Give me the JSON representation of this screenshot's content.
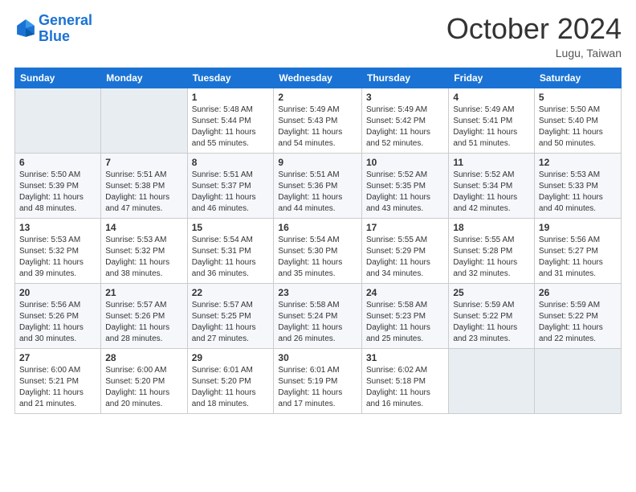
{
  "header": {
    "logo_line1": "General",
    "logo_line2": "Blue",
    "month_title": "October 2024",
    "location": "Lugu, Taiwan"
  },
  "days_of_week": [
    "Sunday",
    "Monday",
    "Tuesday",
    "Wednesday",
    "Thursday",
    "Friday",
    "Saturday"
  ],
  "weeks": [
    [
      {
        "day": "",
        "sunrise": "",
        "sunset": "",
        "daylight": ""
      },
      {
        "day": "",
        "sunrise": "",
        "sunset": "",
        "daylight": ""
      },
      {
        "day": "1",
        "sunrise": "Sunrise: 5:48 AM",
        "sunset": "Sunset: 5:44 PM",
        "daylight": "Daylight: 11 hours and 55 minutes."
      },
      {
        "day": "2",
        "sunrise": "Sunrise: 5:49 AM",
        "sunset": "Sunset: 5:43 PM",
        "daylight": "Daylight: 11 hours and 54 minutes."
      },
      {
        "day": "3",
        "sunrise": "Sunrise: 5:49 AM",
        "sunset": "Sunset: 5:42 PM",
        "daylight": "Daylight: 11 hours and 52 minutes."
      },
      {
        "day": "4",
        "sunrise": "Sunrise: 5:49 AM",
        "sunset": "Sunset: 5:41 PM",
        "daylight": "Daylight: 11 hours and 51 minutes."
      },
      {
        "day": "5",
        "sunrise": "Sunrise: 5:50 AM",
        "sunset": "Sunset: 5:40 PM",
        "daylight": "Daylight: 11 hours and 50 minutes."
      }
    ],
    [
      {
        "day": "6",
        "sunrise": "Sunrise: 5:50 AM",
        "sunset": "Sunset: 5:39 PM",
        "daylight": "Daylight: 11 hours and 48 minutes."
      },
      {
        "day": "7",
        "sunrise": "Sunrise: 5:51 AM",
        "sunset": "Sunset: 5:38 PM",
        "daylight": "Daylight: 11 hours and 47 minutes."
      },
      {
        "day": "8",
        "sunrise": "Sunrise: 5:51 AM",
        "sunset": "Sunset: 5:37 PM",
        "daylight": "Daylight: 11 hours and 46 minutes."
      },
      {
        "day": "9",
        "sunrise": "Sunrise: 5:51 AM",
        "sunset": "Sunset: 5:36 PM",
        "daylight": "Daylight: 11 hours and 44 minutes."
      },
      {
        "day": "10",
        "sunrise": "Sunrise: 5:52 AM",
        "sunset": "Sunset: 5:35 PM",
        "daylight": "Daylight: 11 hours and 43 minutes."
      },
      {
        "day": "11",
        "sunrise": "Sunrise: 5:52 AM",
        "sunset": "Sunset: 5:34 PM",
        "daylight": "Daylight: 11 hours and 42 minutes."
      },
      {
        "day": "12",
        "sunrise": "Sunrise: 5:53 AM",
        "sunset": "Sunset: 5:33 PM",
        "daylight": "Daylight: 11 hours and 40 minutes."
      }
    ],
    [
      {
        "day": "13",
        "sunrise": "Sunrise: 5:53 AM",
        "sunset": "Sunset: 5:32 PM",
        "daylight": "Daylight: 11 hours and 39 minutes."
      },
      {
        "day": "14",
        "sunrise": "Sunrise: 5:53 AM",
        "sunset": "Sunset: 5:32 PM",
        "daylight": "Daylight: 11 hours and 38 minutes."
      },
      {
        "day": "15",
        "sunrise": "Sunrise: 5:54 AM",
        "sunset": "Sunset: 5:31 PM",
        "daylight": "Daylight: 11 hours and 36 minutes."
      },
      {
        "day": "16",
        "sunrise": "Sunrise: 5:54 AM",
        "sunset": "Sunset: 5:30 PM",
        "daylight": "Daylight: 11 hours and 35 minutes."
      },
      {
        "day": "17",
        "sunrise": "Sunrise: 5:55 AM",
        "sunset": "Sunset: 5:29 PM",
        "daylight": "Daylight: 11 hours and 34 minutes."
      },
      {
        "day": "18",
        "sunrise": "Sunrise: 5:55 AM",
        "sunset": "Sunset: 5:28 PM",
        "daylight": "Daylight: 11 hours and 32 minutes."
      },
      {
        "day": "19",
        "sunrise": "Sunrise: 5:56 AM",
        "sunset": "Sunset: 5:27 PM",
        "daylight": "Daylight: 11 hours and 31 minutes."
      }
    ],
    [
      {
        "day": "20",
        "sunrise": "Sunrise: 5:56 AM",
        "sunset": "Sunset: 5:26 PM",
        "daylight": "Daylight: 11 hours and 30 minutes."
      },
      {
        "day": "21",
        "sunrise": "Sunrise: 5:57 AM",
        "sunset": "Sunset: 5:26 PM",
        "daylight": "Daylight: 11 hours and 28 minutes."
      },
      {
        "day": "22",
        "sunrise": "Sunrise: 5:57 AM",
        "sunset": "Sunset: 5:25 PM",
        "daylight": "Daylight: 11 hours and 27 minutes."
      },
      {
        "day": "23",
        "sunrise": "Sunrise: 5:58 AM",
        "sunset": "Sunset: 5:24 PM",
        "daylight": "Daylight: 11 hours and 26 minutes."
      },
      {
        "day": "24",
        "sunrise": "Sunrise: 5:58 AM",
        "sunset": "Sunset: 5:23 PM",
        "daylight": "Daylight: 11 hours and 25 minutes."
      },
      {
        "day": "25",
        "sunrise": "Sunrise: 5:59 AM",
        "sunset": "Sunset: 5:22 PM",
        "daylight": "Daylight: 11 hours and 23 minutes."
      },
      {
        "day": "26",
        "sunrise": "Sunrise: 5:59 AM",
        "sunset": "Sunset: 5:22 PM",
        "daylight": "Daylight: 11 hours and 22 minutes."
      }
    ],
    [
      {
        "day": "27",
        "sunrise": "Sunrise: 6:00 AM",
        "sunset": "Sunset: 5:21 PM",
        "daylight": "Daylight: 11 hours and 21 minutes."
      },
      {
        "day": "28",
        "sunrise": "Sunrise: 6:00 AM",
        "sunset": "Sunset: 5:20 PM",
        "daylight": "Daylight: 11 hours and 20 minutes."
      },
      {
        "day": "29",
        "sunrise": "Sunrise: 6:01 AM",
        "sunset": "Sunset: 5:20 PM",
        "daylight": "Daylight: 11 hours and 18 minutes."
      },
      {
        "day": "30",
        "sunrise": "Sunrise: 6:01 AM",
        "sunset": "Sunset: 5:19 PM",
        "daylight": "Daylight: 11 hours and 17 minutes."
      },
      {
        "day": "31",
        "sunrise": "Sunrise: 6:02 AM",
        "sunset": "Sunset: 5:18 PM",
        "daylight": "Daylight: 11 hours and 16 minutes."
      },
      {
        "day": "",
        "sunrise": "",
        "sunset": "",
        "daylight": ""
      },
      {
        "day": "",
        "sunrise": "",
        "sunset": "",
        "daylight": ""
      }
    ]
  ]
}
